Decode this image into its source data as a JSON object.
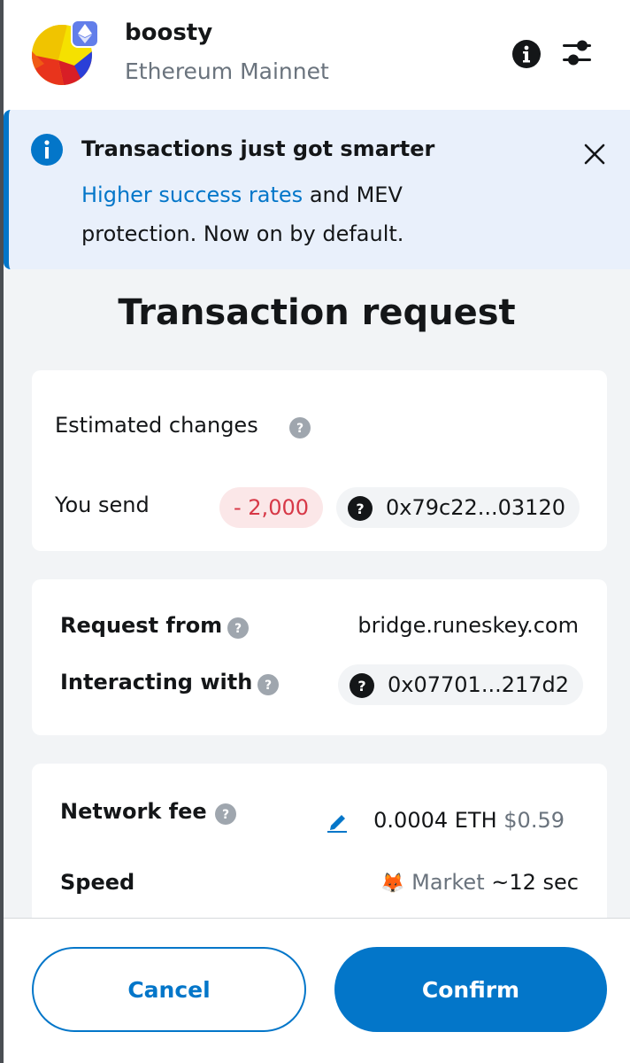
{
  "header": {
    "account_name": "boosty",
    "network_name": "Ethereum Mainnet"
  },
  "banner": {
    "title": "Transactions just got smarter",
    "link_text": "Higher success rates",
    "body_rest": " and MEV protection. Now on by default."
  },
  "page_title": "Transaction request",
  "estimated_changes": {
    "label": "Estimated changes",
    "you_send_label": "You send",
    "amount": "- 2,000",
    "token_address": "0x79c22...03120"
  },
  "request": {
    "request_from_label": "Request from",
    "request_from_value": "bridge.runeskey.com",
    "interacting_with_label": "Interacting with",
    "interacting_with_value": "0x07701...217d2"
  },
  "fee": {
    "network_fee_label": "Network fee",
    "fee_eth": "0.0004 ETH",
    "fee_usd": "$0.59",
    "speed_label": "Speed",
    "speed_name": "Market",
    "speed_time": "~12 sec"
  },
  "footer": {
    "cancel_label": "Cancel",
    "confirm_label": "Confirm"
  },
  "colors": {
    "primary": "#0376c9",
    "banner_bg": "#e9f0fb",
    "error": "#d73847",
    "error_bg": "#fbe7e8",
    "muted": "#6a737d"
  }
}
